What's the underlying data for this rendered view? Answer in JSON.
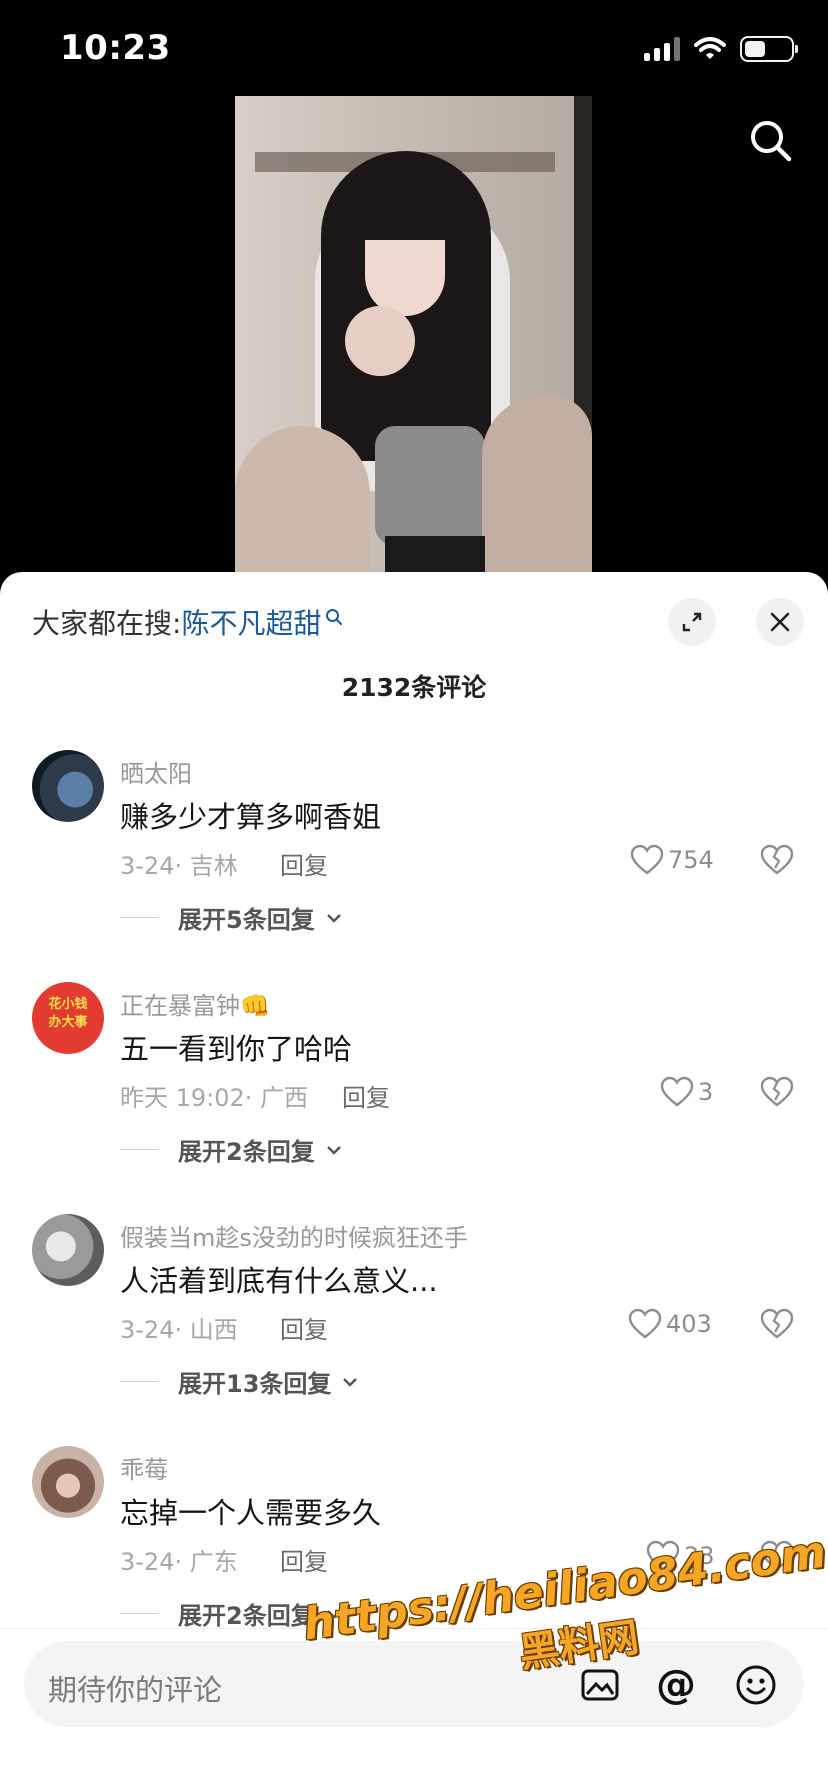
{
  "status_bar": {
    "time": "10:23",
    "battery_level": 0.45
  },
  "hot_search": {
    "prefix": "大家都在搜:",
    "keyword": "陈不凡超甜"
  },
  "comment_count": "2132条评论",
  "comments": [
    {
      "user": "晒太阳",
      "text": "赚多少才算多啊香姐",
      "date": "3-24",
      "location": "吉林",
      "reply": "回复",
      "likes": "754",
      "expand": "展开5条回复"
    },
    {
      "user": "正在暴富钟",
      "user_emoji": "👊",
      "text": "五一看到你了哈哈",
      "date": "昨天 19:02",
      "location": "广西",
      "reply": "回复",
      "likes": "3",
      "expand": "展开2条回复",
      "avatar_text_1": "花小钱",
      "avatar_text_2": "办大事"
    },
    {
      "user": "假装当m趁s没劲的时候疯狂还手",
      "text": "人活着到底有什么意义...",
      "date": "3-24",
      "location": "山西",
      "reply": "回复",
      "likes": "403",
      "expand": "展开13条回复"
    },
    {
      "user": "乖莓",
      "text": "忘掉一个人需要多久",
      "date": "3-24",
      "location": "广东",
      "reply": "回复",
      "likes": "23",
      "expand": "展开2条回复"
    }
  ],
  "input": {
    "placeholder": "期待你的评论",
    "at": "@"
  },
  "watermark": {
    "url": "https://heiliao84.com",
    "label": "黑料网"
  },
  "colors": {
    "keyword": "#1a5a9e",
    "watermark": "#f5a623"
  }
}
